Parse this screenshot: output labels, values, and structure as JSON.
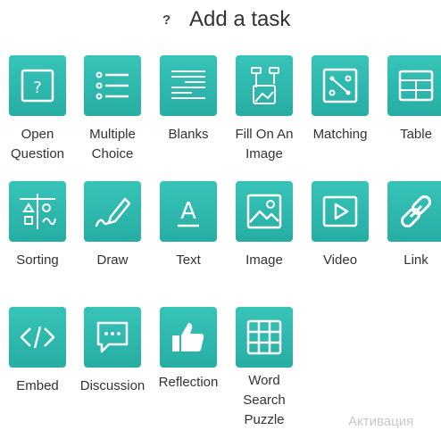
{
  "header": {
    "help_icon": "?",
    "title": "Add a task"
  },
  "tasks": [
    {
      "label_1": "Open",
      "label_2": "Question",
      "icon": "question-box-icon"
    },
    {
      "label_1": "Multiple",
      "label_2": "Choice",
      "icon": "list-icon"
    },
    {
      "label_1": "Blanks",
      "label_2": "",
      "icon": "blanks-icon"
    },
    {
      "label_1": "Fill On An",
      "label_2": "Image",
      "icon": "fill-image-icon"
    },
    {
      "label_1": "Matching",
      "label_2": "",
      "icon": "matching-icon"
    },
    {
      "label_1": "Table",
      "label_2": "",
      "icon": "table-icon"
    },
    {
      "label_1": "Sorting",
      "label_2": "",
      "icon": "sorting-icon"
    },
    {
      "label_1": "Draw",
      "label_2": "",
      "icon": "pencil-icon"
    },
    {
      "label_1": "Text",
      "label_2": "",
      "icon": "text-icon"
    },
    {
      "label_1": "Image",
      "label_2": "",
      "icon": "image-icon"
    },
    {
      "label_1": "Video",
      "label_2": "",
      "icon": "video-icon"
    },
    {
      "label_1": "Link",
      "label_2": "",
      "icon": "link-icon"
    },
    {
      "label_1": "Embed",
      "label_2": "",
      "icon": "code-icon"
    },
    {
      "label_1": "Discussion",
      "label_2": "",
      "icon": "chat-bubble-icon"
    },
    {
      "label_1": "Reflection",
      "label_2": "",
      "icon": "thumbs-up-icon"
    },
    {
      "label_1": "Word",
      "label_2": "Search",
      "label_3": "Puzzle",
      "icon": "grid-icon"
    }
  ],
  "watermark": "Активация",
  "colors": {
    "tile_top": "#37c4b8",
    "tile_bottom": "#27ada3",
    "icon": "#ffffff"
  }
}
